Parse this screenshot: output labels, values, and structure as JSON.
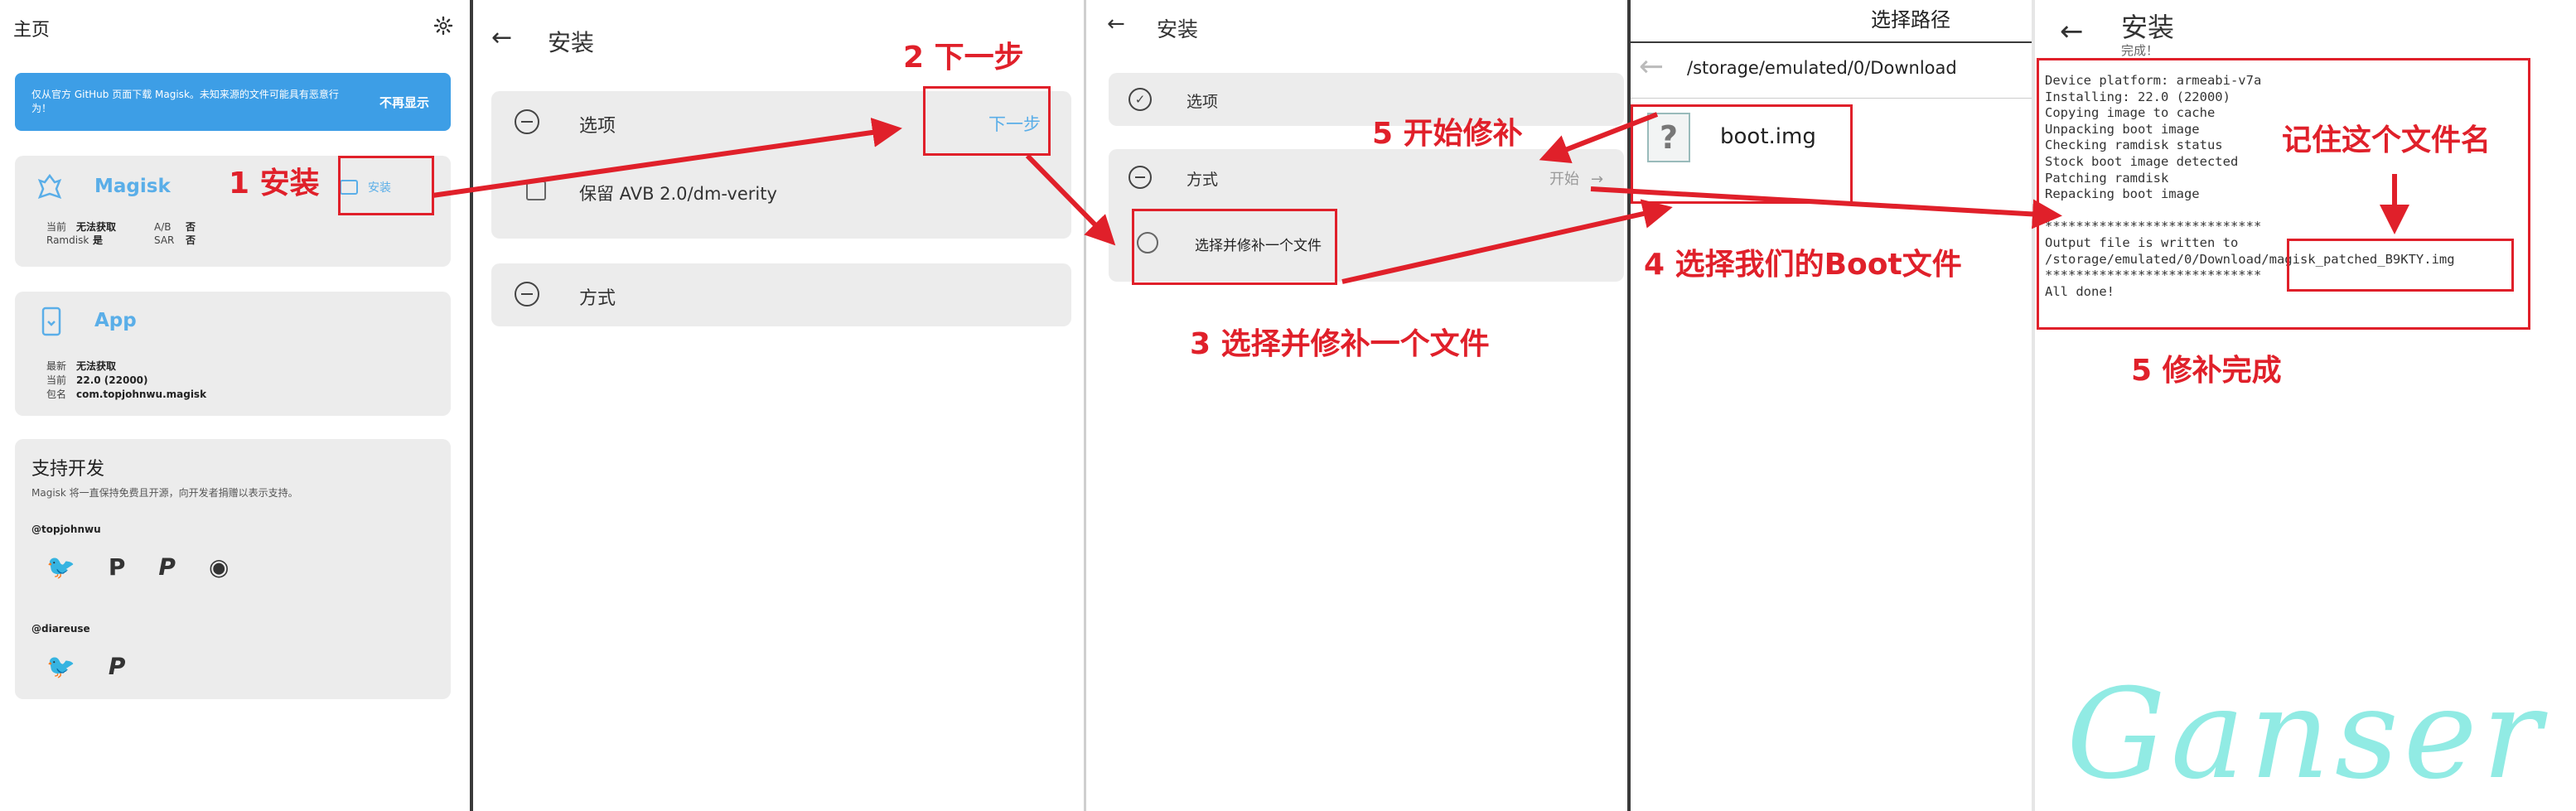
{
  "p1": {
    "title": "主页",
    "banner_text": "仅从官方 GitHub 页面下载 Magisk。未知来源的文件可能具有恶意行为！",
    "banner_button": "不再显示",
    "magisk": {
      "name": "Magisk",
      "install": "安装",
      "current_label": "当前",
      "current_value": "无法获取",
      "ramdisk_label": "Ramdisk",
      "ramdisk_value": "是",
      "ab_label": "A/B",
      "ab_value": "否",
      "sar_label": "SAR",
      "sar_value": "否"
    },
    "app": {
      "name": "App",
      "latest_label": "最新",
      "latest_value": "无法获取",
      "current_label": "当前",
      "current_value": "22.0 (22000)",
      "package_label": "包名",
      "package_value": "com.topjohnwu.magisk"
    },
    "support": {
      "title": "支持开发",
      "desc": "Magisk 将一直保持免费且开源，向开发者捐赠以表示支持。",
      "user1": "@topjohnwu",
      "user2": "@diareuse"
    }
  },
  "p2": {
    "title": "安装",
    "options_label": "选项",
    "next_label": "下一步",
    "avb_label": "保留 AVB 2.0/dm-verity",
    "method_label": "方式"
  },
  "p3": {
    "title": "安装",
    "options_label": "选项",
    "method_label": "方式",
    "start_label": "开始",
    "select_patch_label": "选择并修补一个文件"
  },
  "p4": {
    "title": "选择路径",
    "path": "/storage/emulated/0/Download",
    "file_name": "boot.img"
  },
  "p5": {
    "title": "安装",
    "subtitle": "完成！",
    "log_lines": [
      "Device platform: armeabi-v7a",
      "Installing: 22.0 (22000)",
      "Copying image to cache",
      "Unpacking boot image",
      "Checking ramdisk status",
      "Stock boot image detected",
      "Patching ramdisk",
      "Repacking boot image",
      "",
      "****************************",
      "Output file is written to",
      "/storage/emulated/0/Download/magisk_patched_B9KTY.img",
      "****************************",
      "All done!"
    ]
  },
  "annotations": {
    "step1": "1 安装",
    "step2": "2 下一步",
    "step3": "3 选择并修补一个文件",
    "step4": "4 选择我们的Boot文件",
    "step5a": "5 开始修补",
    "step5b": "5 修补完成",
    "remember": "记住这个文件名"
  },
  "watermark": "Ganser",
  "colors": {
    "accent": "#5aaee8",
    "banner": "#3d9ee6",
    "card": "#ececec",
    "annotation_red": "#e0202a",
    "watermark": "#7ee8e0"
  }
}
